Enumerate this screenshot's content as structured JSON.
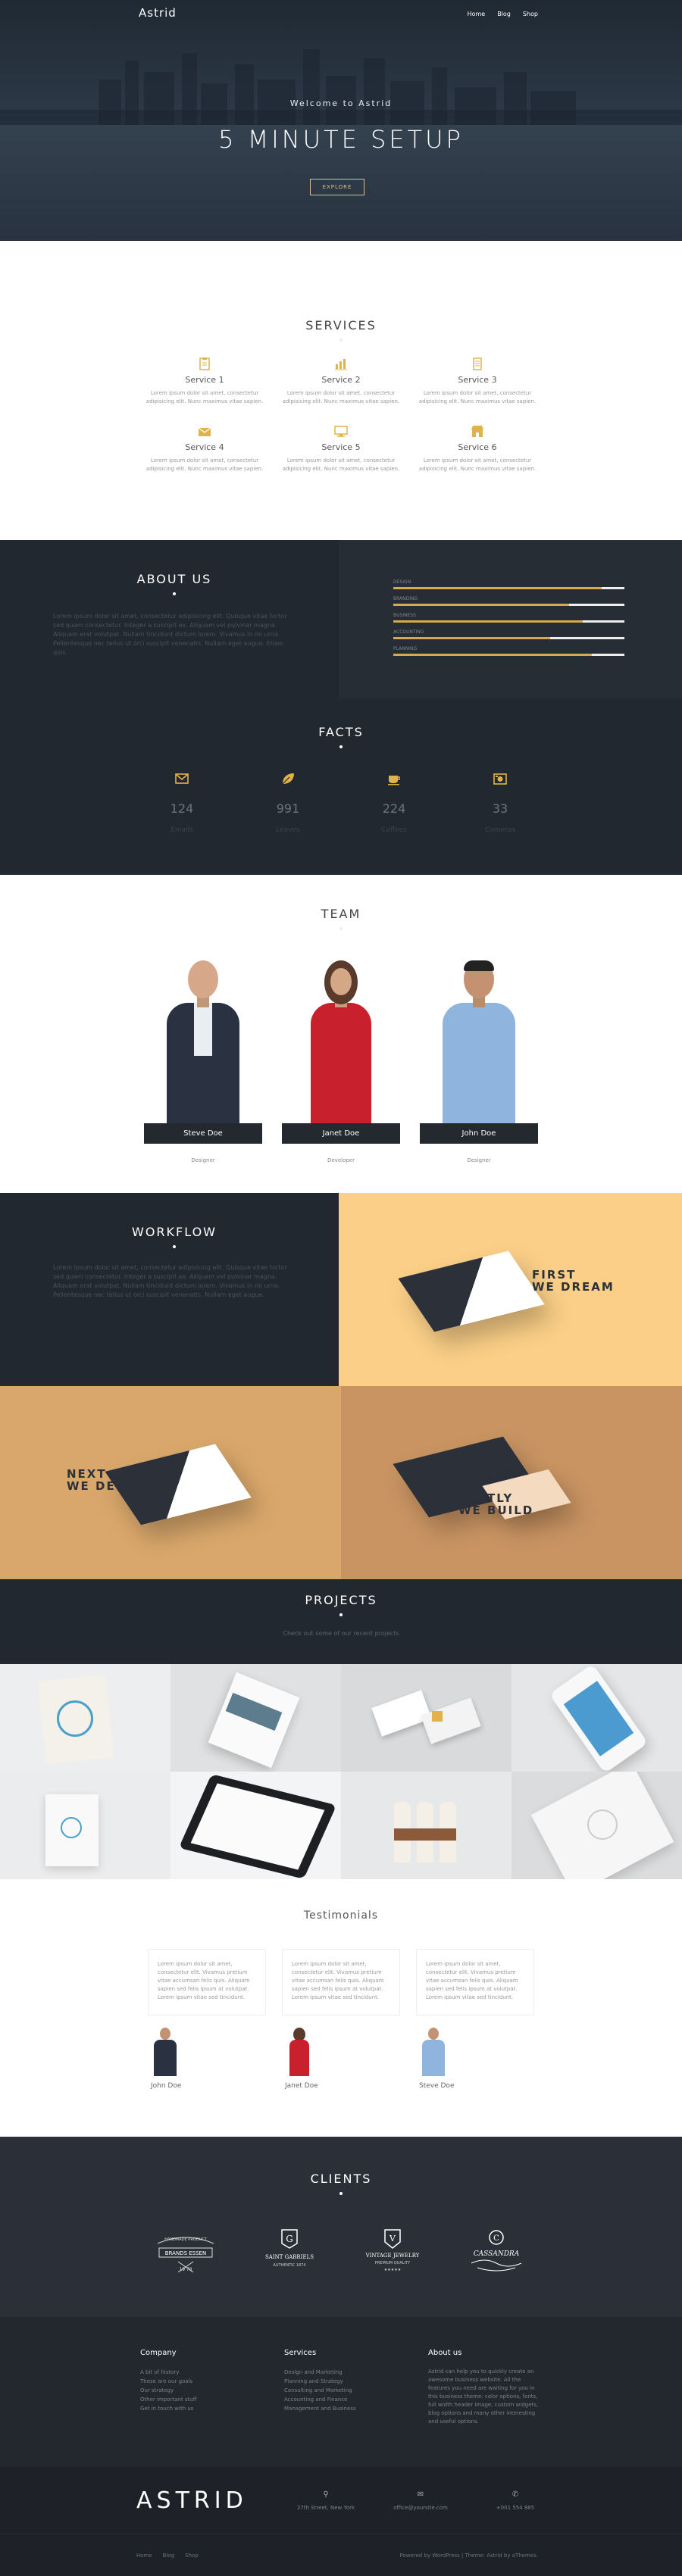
{
  "nav": {
    "brand": "Astrid",
    "items": [
      "Home",
      "Blog",
      "Shop"
    ]
  },
  "hero": {
    "welcome": "Welcome to Astrid",
    "title": "5 MINUTE SETUP",
    "button": "EXPLORE"
  },
  "services": {
    "title": "SERVICES",
    "items": [
      {
        "name": "Service 1",
        "text": "Lorem ipsum dolor sit amet, consectetur adipisicing elit. Nunc maximus vitae sapien.",
        "icon": "clipboard-icon"
      },
      {
        "name": "Service 2",
        "text": "Lorem ipsum dolor sit amet, consectetur adipisicing elit. Nunc maximus vitae sapien.",
        "icon": "chart-icon"
      },
      {
        "name": "Service 3",
        "text": "Lorem ipsum dolor sit amet, consectetur adipisicing elit. Nunc maximus vitae sapien.",
        "icon": "notepad-icon"
      },
      {
        "name": "Service 4",
        "text": "Lorem ipsum dolor sit amet, consectetur adipisicing elit. Nunc maximus vitae sapien.",
        "icon": "envelope-open-icon"
      },
      {
        "name": "Service 5",
        "text": "Lorem ipsum dolor sit amet, consectetur adipisicing elit. Nunc maximus vitae sapien.",
        "icon": "monitor-icon"
      },
      {
        "name": "Service 6",
        "text": "Lorem ipsum dolor sit amet, consectetur adipisicing elit. Nunc maximus vitae sapien.",
        "icon": "store-icon"
      }
    ],
    "accent": "#e0b34a"
  },
  "about": {
    "title": "ABOUT US",
    "text": "Lorem ipsum dolor sit amet, consectetur adipisicing elit. Quisque vitae tortor sed quam consectetur. Integer a suscipit ex. Aliquam vel pulvinar magna. Aliquam erat volutpat. Nullam tincidunt dictum lorem. Vivamus in mi urna. Pellentesque nec tellus ut orci suscipit venenatis. Nullam eget augue. Etiam quis.",
    "skills": [
      {
        "label": "DESIGN",
        "level": 0.9
      },
      {
        "label": "BRANDING",
        "level": 0.76
      },
      {
        "label": "BUSINESS",
        "level": 0.82
      },
      {
        "label": "ACCOUNTING",
        "level": 0.68
      },
      {
        "label": "PLANNING",
        "level": 0.86
      }
    ]
  },
  "facts": {
    "title": "FACTS",
    "items": [
      {
        "num": "124",
        "label": "Emails",
        "icon": "envelope-icon"
      },
      {
        "num": "991",
        "label": "Leaves",
        "icon": "leaf-icon"
      },
      {
        "num": "224",
        "label": "Coffees",
        "icon": "coffee-icon"
      },
      {
        "num": "33",
        "label": "Cameras",
        "icon": "camera-icon"
      }
    ]
  },
  "team": {
    "title": "TEAM",
    "members": [
      {
        "name": "Steve Doe",
        "role": "Designer",
        "suit": "#2a3140",
        "shirt": "#e9eef3"
      },
      {
        "name": "Janet Doe",
        "role": "Developer",
        "suit": "#c8202c",
        "shirt": "#c8202c"
      },
      {
        "name": "John Doe",
        "role": "Designer",
        "suit": "#8fb4dd",
        "shirt": "#8fb4dd"
      }
    ]
  },
  "workflow": {
    "title": "WORKFLOW",
    "text": "Lorem ipsum dolor sit amet, consectetur adipisicing elit. Quisque vitae tortor sed quam consectetur. Integer a suscipit ex. Aliquam vel pulvinar magna. Aliquam erat volutpat. Nullam tincidunt dictum lorem. Vivamus in mi urna. Pellentesque nec tellus ut orci suscipit venenatis. Nullam eget augue.",
    "steps": [
      {
        "line1": "FIRST",
        "line2": "WE DREAM"
      },
      {
        "line1": "NEXT",
        "line2": "WE DESIGN"
      },
      {
        "line1": "LASTLY",
        "line2": "WE BUILD"
      }
    ],
    "colors": {
      "yellow": "#fbcf87",
      "tan": "#d9a76b",
      "tan2": "#c99462"
    }
  },
  "projects": {
    "title": "PROJECTS",
    "subtitle": "Check out some of our recent projects"
  },
  "testimonials": {
    "title": "Testimonials",
    "items": [
      {
        "quote": "Lorem ipsum dolor sit amet, consectetur elit. Vivamus pretium vitae accumsan felis quis. Aliquam sapien sed felis ipsum at volutpat. Lorem ipsum vitae sed tincidunt.",
        "name": "John Doe"
      },
      {
        "quote": "Lorem ipsum dolor sit amet, consectetur elit. Vivamus pretium vitae accumsan felis quis. Aliquam sapien sed felis ipsum at volutpat. Lorem ipsum vitae sed tincidunt.",
        "name": "Janet Doe"
      },
      {
        "quote": "Lorem ipsum dolor sit amet, consectetur elit. Vivamus pretium vitae accumsan felis quis. Aliquam sapien sed felis ipsum at volutpat. Lorem ipsum vitae sed tincidunt.",
        "name": "Steve Doe"
      }
    ]
  },
  "clients": {
    "title": "CLIENTS",
    "logos": [
      {
        "top": "HANDMADE PRODUCT",
        "name": "BRANDS ESSEN",
        "sub": "19  78"
      },
      {
        "top": "",
        "name": "SAINT GABRIELS",
        "sub": "AUTHENTIC 1874"
      },
      {
        "top": "",
        "name": "VINTAGE JEWELRY",
        "sub": "PREMIUM QUALITY"
      },
      {
        "top": "",
        "name": "CASSANDRA",
        "sub": ""
      }
    ]
  },
  "footer": {
    "company": {
      "title": "Company",
      "links": [
        "A bit of history",
        "These are our goals",
        "Our strategy",
        "Other important stuff",
        "Get in touch with us"
      ]
    },
    "services": {
      "title": "Services",
      "links": [
        "Design and Marketing",
        "Planning and Strategy",
        "Consulting and Marketing",
        "Accounting and Finance",
        "Management and Business"
      ]
    },
    "about": {
      "title": "About us",
      "text": "Astrid can help you to quickly create an awesome business website. All the features you need are waiting for you in this business theme: color options, fonts, full width header image, custom widgets, blog options and many other interesting and useful options."
    },
    "brand": "ASTRID",
    "contact": [
      {
        "icon": "map-marker-icon",
        "text": "27th Street, New York"
      },
      {
        "icon": "envelope-icon",
        "text": "office@yoursite.com"
      },
      {
        "icon": "phone-icon",
        "text": "+001 554 885"
      }
    ],
    "bottom_links": [
      "Home",
      "Blog",
      "Shop"
    ],
    "credit": "Powered by WordPress | Theme: Astrid by aThemes."
  }
}
